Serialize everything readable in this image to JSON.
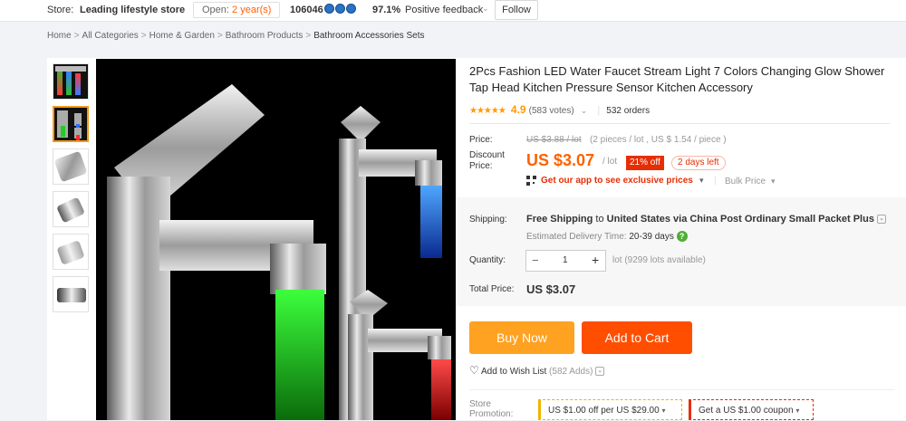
{
  "store": {
    "label": "Store:",
    "name": "Leading lifestyle store",
    "open_prefix": "Open:",
    "open_value": "2 year(s)",
    "score": "106046",
    "feedback_pct": "97.1%",
    "feedback_label": "Positive feedback",
    "follow": "Follow"
  },
  "breadcrumb": [
    "Home",
    "All Categories",
    "Home & Garden",
    "Bathroom Products",
    "Bathroom Accessories Sets"
  ],
  "product": {
    "title": "2Pcs Fashion LED Water Faucet Stream Light 7 Colors Changing Glow Shower Tap Head Kitchen Pressure Sensor Kitchen Accessory",
    "rating": "4.9",
    "votes": "(583 votes)",
    "orders": "532 orders",
    "rating_fraction": 0.98
  },
  "price": {
    "label": "Price:",
    "original": "US $3.88 / lot",
    "original_note": "(2 pieces / lot , US $ 1.54 / piece )",
    "discount_label": "Discount Price:",
    "discount": "US $3.07",
    "unit": "/ lot",
    "off_badge": "21% off",
    "days_left": "2 days left",
    "app_promo": "Get our app to see exclusive prices",
    "bulk": "Bulk Price"
  },
  "shipping": {
    "label": "Shipping:",
    "free": "Free Shipping",
    "to": "to",
    "country": "United States",
    "via": "via China Post Ordinary Small Packet Plus",
    "estimate_label": "Estimated Delivery Time:",
    "estimate_value": "20-39 days"
  },
  "quantity": {
    "label": "Quantity:",
    "minus": "−",
    "value": "1",
    "plus": "+",
    "available": "lot (9299 lots available)"
  },
  "total": {
    "label": "Total Price:",
    "value": "US $3.07"
  },
  "actions": {
    "buy_now": "Buy Now",
    "add_to_cart": "Add to Cart",
    "wishlist": "Add to Wish List",
    "wishlist_adds": "(582 Adds)"
  },
  "promotion": {
    "label": "Store Promotion:",
    "offer1": "US $1.00 off per US $29.00",
    "offer2": "Get a US $1.00 coupon"
  },
  "colors": {
    "orange": "#ff6000",
    "buy_now": "#ffa121",
    "add_to_cart": "#ff4e00",
    "badge_red": "#e62e04",
    "star": "#ff9a00"
  }
}
